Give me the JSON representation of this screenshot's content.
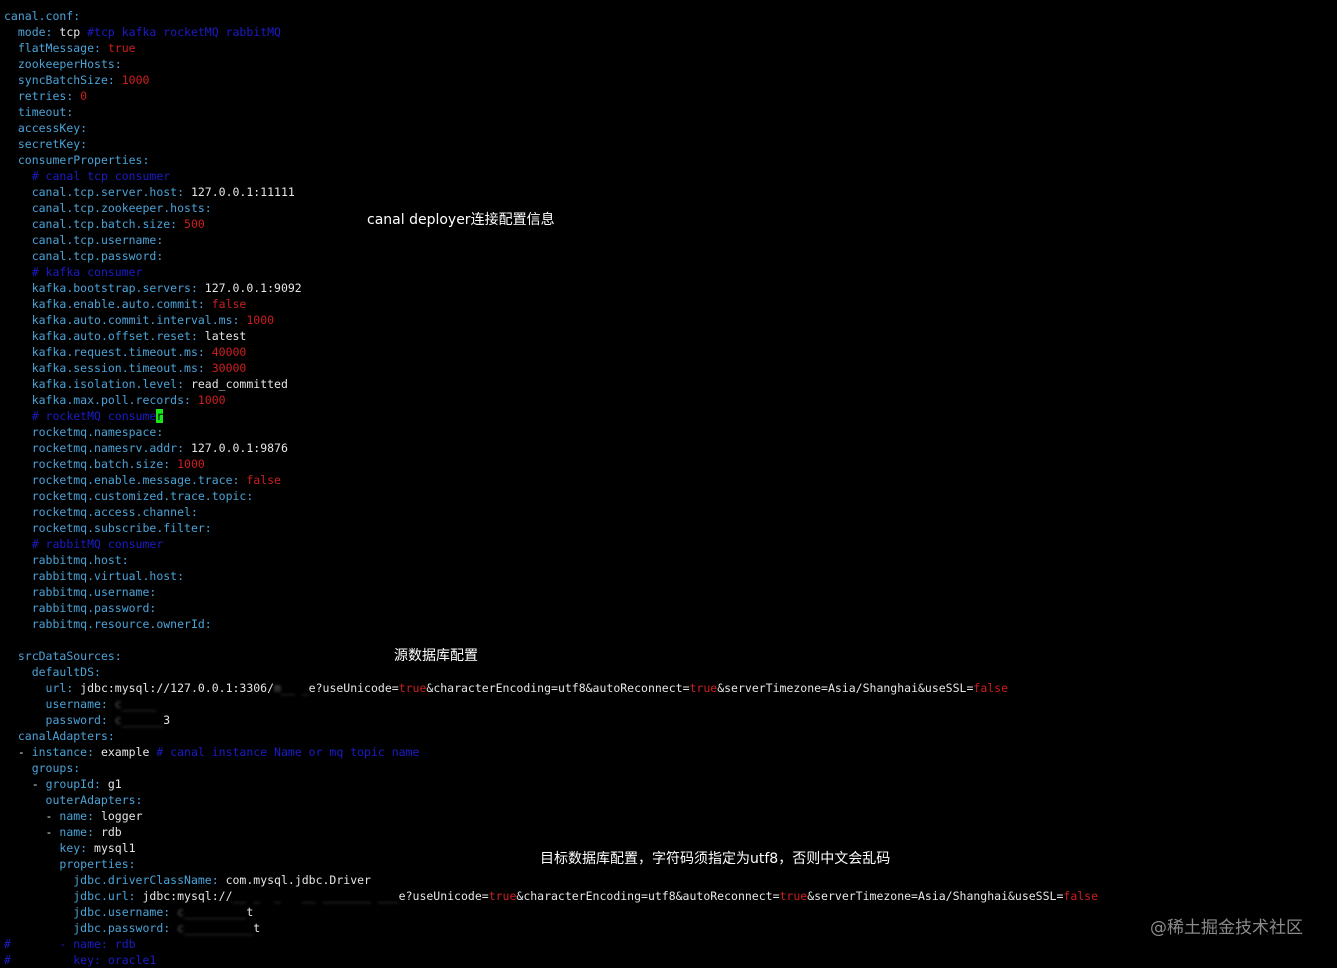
{
  "annotations": {
    "deployer": "canal deployer连接配置信息",
    "source": "源数据库配置",
    "target": "目标数据库配置，字符码须指定为utf8，否则中文会乱码"
  },
  "watermark": "@稀土掘金技术社区",
  "colors": {
    "background": "#000000",
    "key": "#4aa3d8",
    "value": "#e6e6e6",
    "number": "#cc1f1f",
    "comment": "#1c1cc8",
    "cursor": "#19e619"
  },
  "lines": [
    {
      "indent": "",
      "parts": [
        {
          "t": "canal.conf:",
          "c": "k"
        }
      ]
    },
    {
      "indent": "  ",
      "parts": [
        {
          "t": "mode:",
          "c": "k"
        },
        {
          "t": " tcp ",
          "c": "v"
        },
        {
          "t": "#tcp kafka rocketMQ rabbitMQ",
          "c": "c"
        }
      ]
    },
    {
      "indent": "  ",
      "parts": [
        {
          "t": "flatMessage:",
          "c": "k"
        },
        {
          "t": " true",
          "c": "n"
        }
      ]
    },
    {
      "indent": "  ",
      "parts": [
        {
          "t": "zookeeperHosts:",
          "c": "k"
        }
      ]
    },
    {
      "indent": "  ",
      "parts": [
        {
          "t": "syncBatchSize:",
          "c": "k"
        },
        {
          "t": " 1000",
          "c": "n"
        }
      ]
    },
    {
      "indent": "  ",
      "parts": [
        {
          "t": "retries:",
          "c": "k"
        },
        {
          "t": " 0",
          "c": "n"
        }
      ]
    },
    {
      "indent": "  ",
      "parts": [
        {
          "t": "timeout:",
          "c": "k"
        }
      ]
    },
    {
      "indent": "  ",
      "parts": [
        {
          "t": "accessKey:",
          "c": "k"
        }
      ]
    },
    {
      "indent": "  ",
      "parts": [
        {
          "t": "secretKey:",
          "c": "k"
        }
      ]
    },
    {
      "indent": "  ",
      "parts": [
        {
          "t": "consumerProperties:",
          "c": "k"
        }
      ]
    },
    {
      "indent": "    ",
      "parts": [
        {
          "t": "# canal tcp consumer",
          "c": "c"
        }
      ]
    },
    {
      "indent": "    ",
      "parts": [
        {
          "t": "canal.tcp.server.host:",
          "c": "k"
        },
        {
          "t": " 127.0.0.1:11111",
          "c": "v"
        }
      ]
    },
    {
      "indent": "    ",
      "parts": [
        {
          "t": "canal.tcp.zookeeper.hosts:",
          "c": "k"
        }
      ]
    },
    {
      "indent": "    ",
      "parts": [
        {
          "t": "canal.tcp.batch.size:",
          "c": "k"
        },
        {
          "t": " 500",
          "c": "n"
        }
      ]
    },
    {
      "indent": "    ",
      "parts": [
        {
          "t": "canal.tcp.username:",
          "c": "k"
        }
      ]
    },
    {
      "indent": "    ",
      "parts": [
        {
          "t": "canal.tcp.password:",
          "c": "k"
        }
      ]
    },
    {
      "indent": "    ",
      "parts": [
        {
          "t": "# kafka consumer",
          "c": "c"
        }
      ]
    },
    {
      "indent": "    ",
      "parts": [
        {
          "t": "kafka.bootstrap.servers:",
          "c": "k"
        },
        {
          "t": " 127.0.0.1:9092",
          "c": "v"
        }
      ]
    },
    {
      "indent": "    ",
      "parts": [
        {
          "t": "kafka.enable.auto.commit:",
          "c": "k"
        },
        {
          "t": " false",
          "c": "n"
        }
      ]
    },
    {
      "indent": "    ",
      "parts": [
        {
          "t": "kafka.auto.commit.interval.ms:",
          "c": "k"
        },
        {
          "t": " 1000",
          "c": "n"
        }
      ]
    },
    {
      "indent": "    ",
      "parts": [
        {
          "t": "kafka.auto.offset.reset:",
          "c": "k"
        },
        {
          "t": " latest",
          "c": "v"
        }
      ]
    },
    {
      "indent": "    ",
      "parts": [
        {
          "t": "kafka.request.timeout.ms:",
          "c": "k"
        },
        {
          "t": " 40000",
          "c": "n"
        }
      ]
    },
    {
      "indent": "    ",
      "parts": [
        {
          "t": "kafka.session.timeout.ms:",
          "c": "k"
        },
        {
          "t": " 30000",
          "c": "n"
        }
      ]
    },
    {
      "indent": "    ",
      "parts": [
        {
          "t": "kafka.isolation.level:",
          "c": "k"
        },
        {
          "t": " read_committed",
          "c": "v"
        }
      ]
    },
    {
      "indent": "    ",
      "parts": [
        {
          "t": "kafka.max.poll.records:",
          "c": "k"
        },
        {
          "t": " 1000",
          "c": "n"
        }
      ]
    },
    {
      "indent": "    ",
      "parts": [
        {
          "t": "# rocketMQ consume",
          "c": "c"
        },
        {
          "t": "r",
          "c": "cursor"
        }
      ]
    },
    {
      "indent": "    ",
      "parts": [
        {
          "t": "rocketmq.namespace:",
          "c": "k"
        }
      ]
    },
    {
      "indent": "    ",
      "parts": [
        {
          "t": "rocketmq.namesrv.addr:",
          "c": "k"
        },
        {
          "t": " 127.0.0.1:9876",
          "c": "v"
        }
      ]
    },
    {
      "indent": "    ",
      "parts": [
        {
          "t": "rocketmq.batch.size:",
          "c": "k"
        },
        {
          "t": " 1000",
          "c": "n"
        }
      ]
    },
    {
      "indent": "    ",
      "parts": [
        {
          "t": "rocketmq.enable.message.trace:",
          "c": "k"
        },
        {
          "t": " false",
          "c": "n"
        }
      ]
    },
    {
      "indent": "    ",
      "parts": [
        {
          "t": "rocketmq.customized.trace.topic:",
          "c": "k"
        }
      ]
    },
    {
      "indent": "    ",
      "parts": [
        {
          "t": "rocketmq.access.channel:",
          "c": "k"
        }
      ]
    },
    {
      "indent": "    ",
      "parts": [
        {
          "t": "rocketmq.subscribe.filter:",
          "c": "k"
        }
      ]
    },
    {
      "indent": "    ",
      "parts": [
        {
          "t": "# rabbitMQ consumer",
          "c": "c"
        }
      ]
    },
    {
      "indent": "    ",
      "parts": [
        {
          "t": "rabbitmq.host:",
          "c": "k"
        }
      ]
    },
    {
      "indent": "    ",
      "parts": [
        {
          "t": "rabbitmq.virtual.host:",
          "c": "k"
        }
      ]
    },
    {
      "indent": "    ",
      "parts": [
        {
          "t": "rabbitmq.username:",
          "c": "k"
        }
      ]
    },
    {
      "indent": "    ",
      "parts": [
        {
          "t": "rabbitmq.password:",
          "c": "k"
        }
      ]
    },
    {
      "indent": "    ",
      "parts": [
        {
          "t": "rabbitmq.resource.ownerId:",
          "c": "k"
        }
      ]
    },
    {
      "indent": "",
      "parts": []
    },
    {
      "indent": "  ",
      "parts": [
        {
          "t": "srcDataSources:",
          "c": "k"
        }
      ]
    },
    {
      "indent": "    ",
      "parts": [
        {
          "t": "defaultDS:",
          "c": "k"
        }
      ]
    },
    {
      "indent": "      ",
      "parts": [
        {
          "t": "url:",
          "c": "k"
        },
        {
          "t": " jdbc:mysql://127.0.0.1:3306/",
          "c": "v"
        },
        {
          "t": "m__ _",
          "c": "blur"
        },
        {
          "t": "e?useUnicode=",
          "c": "v"
        },
        {
          "t": "true",
          "c": "n"
        },
        {
          "t": "&characterEncoding=utf8&autoReconnect=",
          "c": "v"
        },
        {
          "t": "true",
          "c": "n"
        },
        {
          "t": "&serverTimezone=Asia/Shanghai&useSSL=",
          "c": "v"
        },
        {
          "t": "false",
          "c": "n"
        }
      ]
    },
    {
      "indent": "      ",
      "parts": [
        {
          "t": "username:",
          "c": "k"
        },
        {
          "t": " ",
          "c": "v"
        },
        {
          "t": "c_____",
          "c": "blur"
        }
      ]
    },
    {
      "indent": "      ",
      "parts": [
        {
          "t": "password:",
          "c": "k"
        },
        {
          "t": " ",
          "c": "v"
        },
        {
          "t": "c______",
          "c": "blur"
        },
        {
          "t": "3",
          "c": "v"
        }
      ]
    },
    {
      "indent": "  ",
      "parts": [
        {
          "t": "canalAdapters:",
          "c": "k"
        }
      ]
    },
    {
      "indent": "  ",
      "parts": [
        {
          "t": "- ",
          "c": "v"
        },
        {
          "t": "instance:",
          "c": "k"
        },
        {
          "t": " example ",
          "c": "v"
        },
        {
          "t": "# canal instance Name or mq topic name",
          "c": "c"
        }
      ]
    },
    {
      "indent": "    ",
      "parts": [
        {
          "t": "groups:",
          "c": "k"
        }
      ]
    },
    {
      "indent": "    ",
      "parts": [
        {
          "t": "- ",
          "c": "v"
        },
        {
          "t": "groupId:",
          "c": "k"
        },
        {
          "t": " g1",
          "c": "v"
        }
      ]
    },
    {
      "indent": "      ",
      "parts": [
        {
          "t": "outerAdapters:",
          "c": "k"
        }
      ]
    },
    {
      "indent": "      ",
      "parts": [
        {
          "t": "- ",
          "c": "v"
        },
        {
          "t": "name:",
          "c": "k"
        },
        {
          "t": " logger",
          "c": "v"
        }
      ]
    },
    {
      "indent": "      ",
      "parts": [
        {
          "t": "- ",
          "c": "v"
        },
        {
          "t": "name:",
          "c": "k"
        },
        {
          "t": " rdb",
          "c": "v"
        }
      ]
    },
    {
      "indent": "        ",
      "parts": [
        {
          "t": "key:",
          "c": "k"
        },
        {
          "t": " mysql1",
          "c": "v"
        }
      ]
    },
    {
      "indent": "        ",
      "parts": [
        {
          "t": "properties:",
          "c": "k"
        }
      ]
    },
    {
      "indent": "          ",
      "parts": [
        {
          "t": "jdbc.driverClassName:",
          "c": "k"
        },
        {
          "t": " com.mysql.jdbc.Driver",
          "c": "v"
        }
      ]
    },
    {
      "indent": "          ",
      "parts": [
        {
          "t": "jdbc.url:",
          "c": "k"
        },
        {
          "t": " jdbc:mysql://",
          "c": "v"
        },
        {
          "t": "__ _  _   __ _______ ___",
          "c": "blur"
        },
        {
          "t": "e?useUnicode=",
          "c": "v"
        },
        {
          "t": "true",
          "c": "n"
        },
        {
          "t": "&characterEncoding=utf8&autoReconnect=",
          "c": "v"
        },
        {
          "t": "true",
          "c": "n"
        },
        {
          "t": "&serverTimezone=Asia/Shanghai&useSSL=",
          "c": "v"
        },
        {
          "t": "false",
          "c": "n"
        }
      ]
    },
    {
      "indent": "          ",
      "parts": [
        {
          "t": "jdbc.username:",
          "c": "k"
        },
        {
          "t": " ",
          "c": "v"
        },
        {
          "t": "c_________",
          "c": "blur"
        },
        {
          "t": "t",
          "c": "v"
        }
      ]
    },
    {
      "indent": "          ",
      "parts": [
        {
          "t": "jdbc.password:",
          "c": "k"
        },
        {
          "t": " ",
          "c": "v"
        },
        {
          "t": "c__________",
          "c": "blur"
        },
        {
          "t": "t",
          "c": "v"
        }
      ]
    },
    {
      "indent": "",
      "parts": [
        {
          "t": "#       - name: rdb",
          "c": "c"
        }
      ]
    },
    {
      "indent": "",
      "parts": [
        {
          "t": "#         key: oracle1",
          "c": "c"
        }
      ]
    }
  ]
}
